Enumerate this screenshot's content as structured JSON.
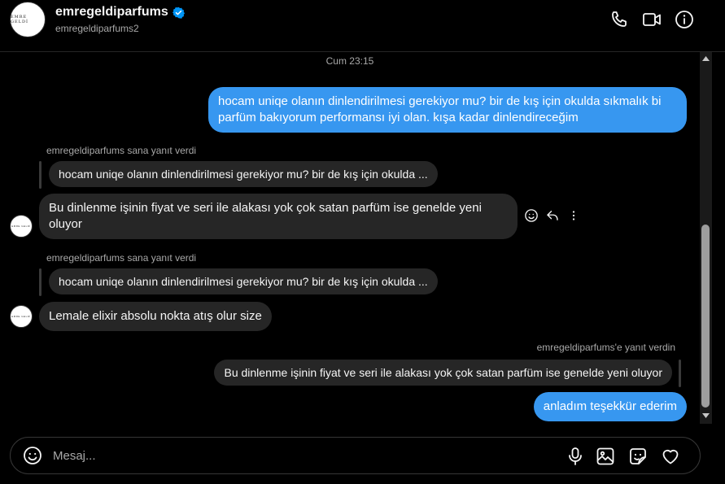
{
  "header": {
    "username": "emregeldiparfums",
    "handle": "emregeldiparfums2",
    "avatar_logo": "EMRE GELDİ"
  },
  "thread": {
    "timestamp": "Cum 23:15",
    "messages": [
      {
        "type": "out",
        "text": "hocam uniqe olanın dinlendirilmesi gerekiyor mu? bir de kış için okulda sıkmalık bi parfüm bakıyorum performansı iyi olan. kışa kadar dinlendireceğim"
      },
      {
        "type": "in_reply",
        "reply_label": "emregeldiparfums sana yanıt verdi",
        "quoted": "hocam uniqe olanın dinlendirilmesi gerekiyor mu? bir de kış için okulda ...",
        "text": "Bu dinlenme işinin fiyat ve seri ile alakası yok çok satan parfüm ise genelde yeni oluyor"
      },
      {
        "type": "in_reply",
        "reply_label": "emregeldiparfums sana yanıt verdi",
        "quoted": "hocam uniqe olanın dinlendirilmesi gerekiyor mu? bir de kış için okulda ...",
        "text": "Lemale elixir absolu nokta atış olur size"
      },
      {
        "type": "out_reply",
        "reply_label": "emregeldiparfums'e yanıt verdin",
        "quoted": "Bu dinlenme işinin fiyat ve seri ile alakası yok çok satan parfüm ise genelde yeni oluyor",
        "text": "anladım teşekkür ederim"
      }
    ]
  },
  "composer": {
    "placeholder": "Mesaj..."
  },
  "icons": {
    "verified_color": "#0095f6",
    "accent": "#3797f0"
  }
}
